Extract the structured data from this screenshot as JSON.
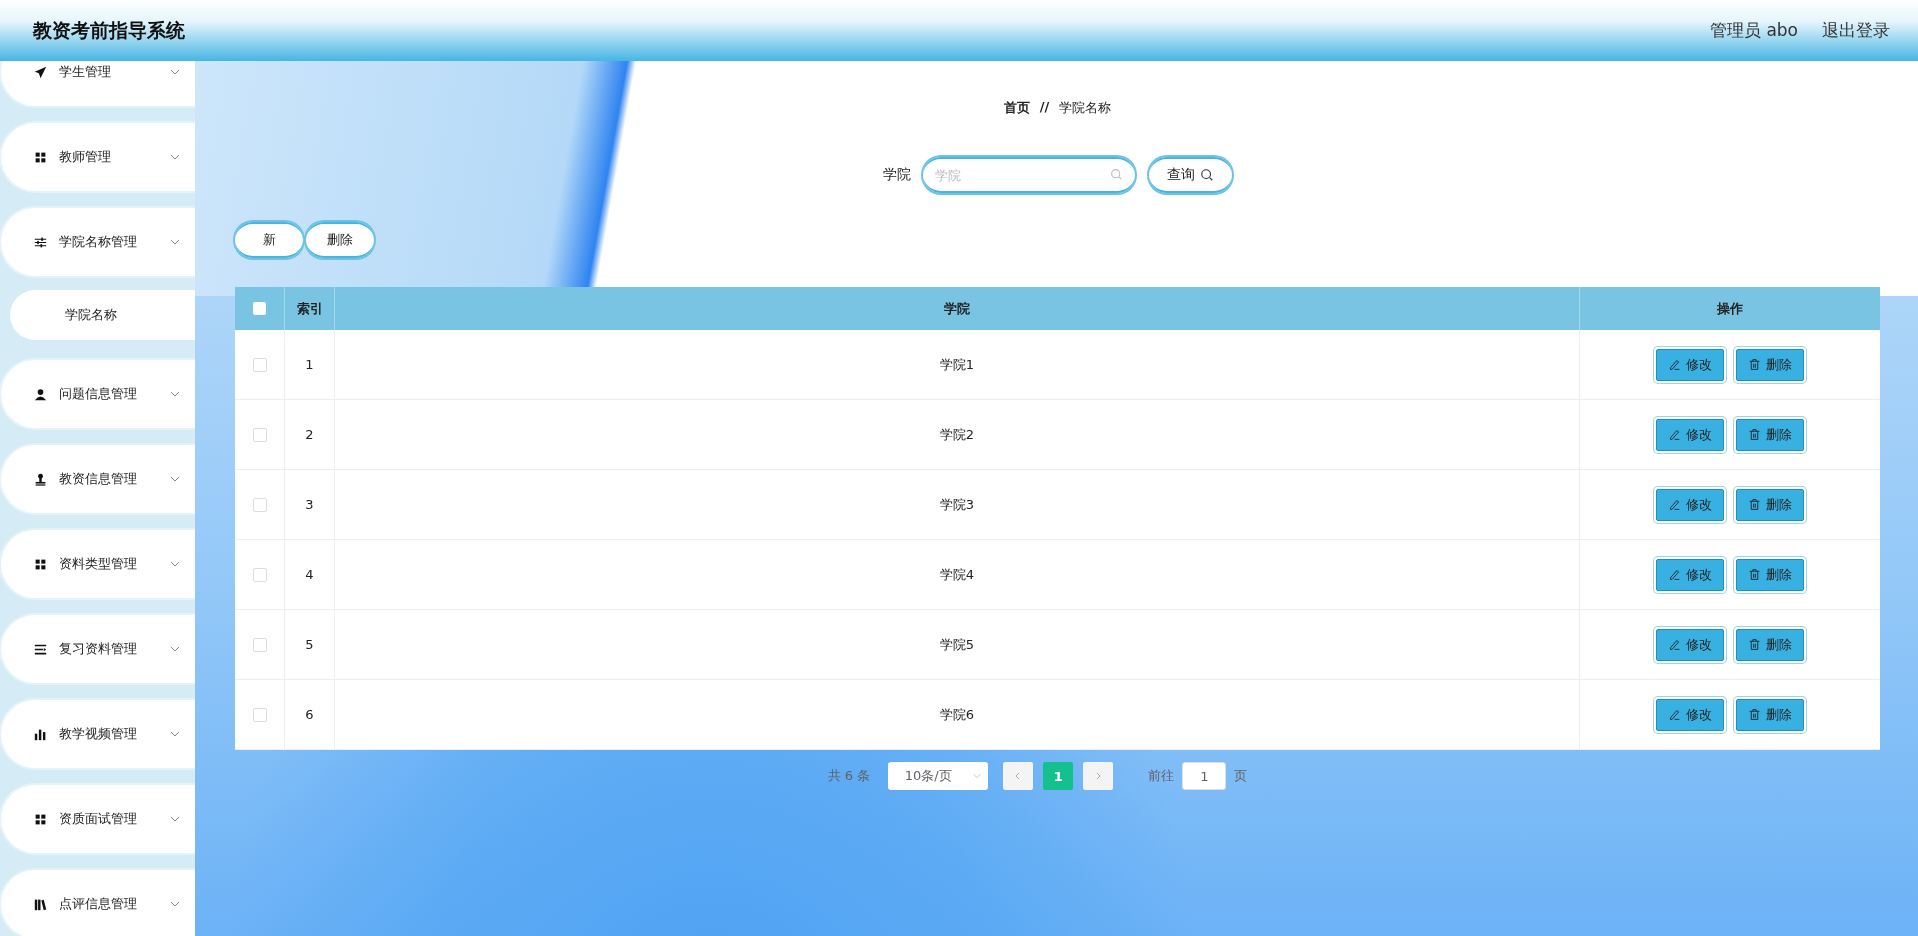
{
  "header": {
    "title": "教资考前指导系统",
    "user": "管理员 abo",
    "logout": "退出登录"
  },
  "sidebar": {
    "items": [
      {
        "label": "学生管理",
        "kind": "plane"
      },
      {
        "label": "教师管理",
        "kind": "grid"
      },
      {
        "label": "学院名称管理",
        "kind": "sliders",
        "children": [
          {
            "label": "学院名称"
          }
        ]
      },
      {
        "label": "问题信息管理",
        "kind": "user"
      },
      {
        "label": "教资信息管理",
        "kind": "stamp"
      },
      {
        "label": "资料类型管理",
        "kind": "grid"
      },
      {
        "label": "复习资料管理",
        "kind": "list"
      },
      {
        "label": "教学视频管理",
        "kind": "bars"
      },
      {
        "label": "资质面试管理",
        "kind": "grid"
      },
      {
        "label": "点评信息管理",
        "kind": "books"
      }
    ]
  },
  "breadcrumb": {
    "home": "首页",
    "separator": "//",
    "current": "学院名称"
  },
  "search": {
    "label": "学院",
    "placeholder": "学院",
    "button": "查询"
  },
  "actions": [
    "新",
    "删除"
  ],
  "table": {
    "select_all_checked": false,
    "columns": [
      "索引",
      "学院",
      "操作"
    ],
    "rows": [
      {
        "index": "1",
        "name": "学院1",
        "checked": false,
        "actions": [
          "修改",
          "删除"
        ]
      },
      {
        "index": "2",
        "name": "学院2",
        "checked": false,
        "actions": [
          "修改",
          "删除"
        ]
      },
      {
        "index": "3",
        "name": "学院3",
        "checked": false,
        "actions": [
          "修改",
          "删除"
        ]
      },
      {
        "index": "4",
        "name": "学院4",
        "checked": false,
        "actions": [
          "修改",
          "删除"
        ]
      },
      {
        "index": "5",
        "name": "学院5",
        "checked": false,
        "actions": [
          "修改",
          "删除"
        ]
      },
      {
        "index": "6",
        "name": "学院6",
        "checked": false,
        "actions": [
          "修改",
          "删除"
        ]
      }
    ]
  },
  "pagination": {
    "total": "共 6 条",
    "page_size": "10条/页",
    "pages": [
      {
        "label": "1",
        "selected": true
      }
    ],
    "goto_label": "前往",
    "goto_value": "1",
    "goto_suffix": "页"
  }
}
